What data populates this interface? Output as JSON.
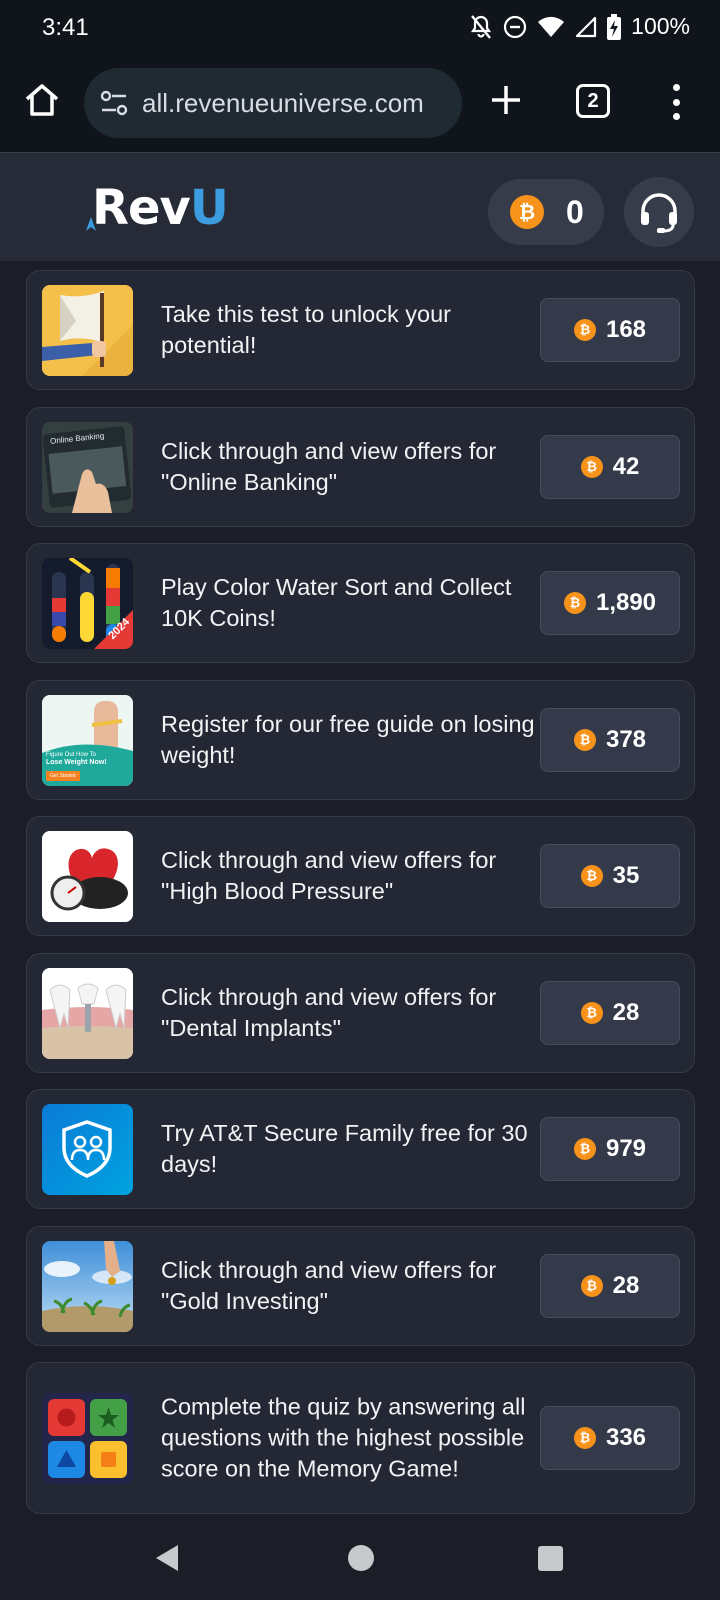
{
  "status_bar": {
    "time": "3:41",
    "battery": "100%",
    "icons": [
      "notifications-off-icon",
      "do-not-disturb-icon",
      "wifi-icon",
      "cell-signal-icon",
      "battery-charging-icon"
    ]
  },
  "browser": {
    "url": "all.revenueuniverse.com",
    "tab_count": "2"
  },
  "header": {
    "logo_rev": "Rev",
    "logo_u": "U",
    "balance": "0"
  },
  "offers": [
    {
      "title": "Take this test to unlock your potential!",
      "reward": "168",
      "thumb": "test-thumbnail"
    },
    {
      "title": "Click through and view offers for \"Online Banking\"",
      "reward": "42",
      "thumb": "online-banking-thumbnail"
    },
    {
      "title": "Play Color Water Sort and Collect 10K Coins!",
      "reward": "1,890",
      "thumb": "water-sort-thumbnail"
    },
    {
      "title": "Register for our free guide on losing weight!",
      "reward": "378",
      "thumb": "weight-loss-thumbnail"
    },
    {
      "title": "Click through and view offers for \"High Blood Pressure\"",
      "reward": "35",
      "thumb": "blood-pressure-thumbnail"
    },
    {
      "title": "Click through and view offers for \"Dental Implants\"",
      "reward": "28",
      "thumb": "dental-implants-thumbnail"
    },
    {
      "title": "Try AT&T Secure Family free for 30 days!",
      "reward": "979",
      "thumb": "att-secure-family-thumbnail"
    },
    {
      "title": "Click through and view offers for \"Gold Investing\"",
      "reward": "28",
      "thumb": "gold-investing-thumbnail"
    },
    {
      "title": "Complete the quiz by answering all questions with the highest possible score on the Memory Game!",
      "reward": "336",
      "thumb": "memory-game-thumbnail"
    }
  ],
  "thumb_texts": {
    "online_banking": "Online Banking",
    "weight_loss_line1": "Figure Out How To",
    "weight_loss_line2": "Lose Weight Now!",
    "weight_loss_cta": "Get Started",
    "water_sort_year": "2024"
  },
  "colors": {
    "coin": "#f7931a",
    "logo_accent": "#3b9de0",
    "card_bg": "#242834",
    "page_bg": "#1b1e27"
  }
}
